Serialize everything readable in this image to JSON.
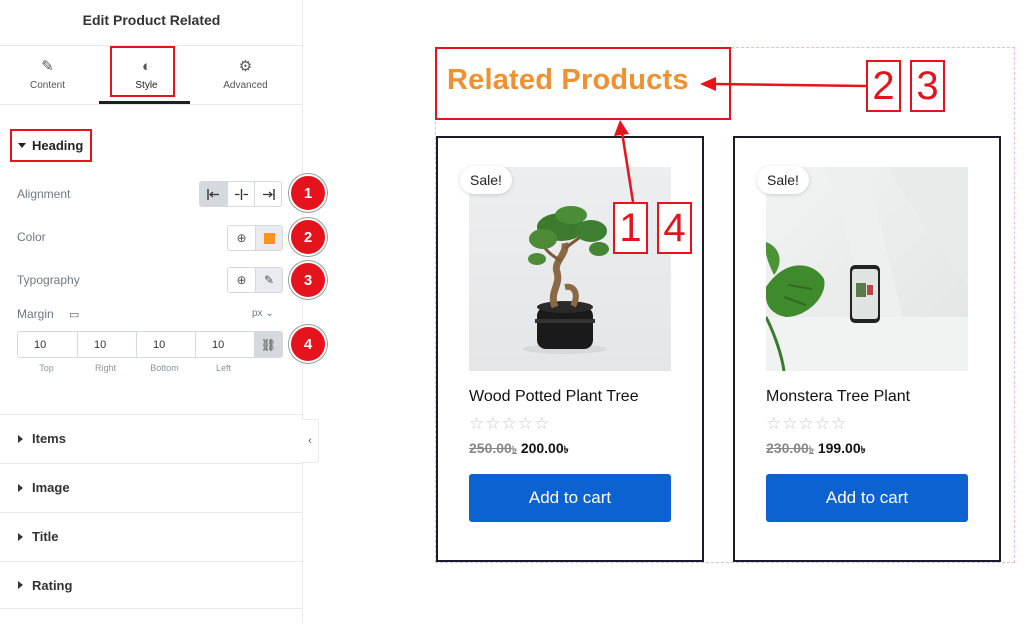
{
  "panel": {
    "title": "Edit Product Related",
    "tabs": [
      {
        "label": "Content",
        "icon": "pencil-icon"
      },
      {
        "label": "Style",
        "icon": "contrast-icon",
        "active": true
      },
      {
        "label": "Advanced",
        "icon": "gear-icon"
      }
    ],
    "heading_section": {
      "label": "Heading",
      "alignment_label": "Alignment",
      "alignment_options": [
        "left",
        "center",
        "right"
      ],
      "alignment_selected": "left",
      "color_label": "Color",
      "color_value": "#f7931e",
      "typography_label": "Typography",
      "margin_label": "Margin",
      "margin_unit": "px",
      "margin_values": [
        {
          "value": "10",
          "label": "Top"
        },
        {
          "value": "10",
          "label": "Right"
        },
        {
          "value": "10",
          "label": "Bottom"
        },
        {
          "value": "10",
          "label": "Left"
        }
      ]
    },
    "sections": [
      {
        "label": "Items"
      },
      {
        "label": "Image"
      },
      {
        "label": "Title"
      },
      {
        "label": "Rating"
      }
    ],
    "badges": [
      "1",
      "2",
      "3",
      "4"
    ]
  },
  "preview": {
    "heading": "Related Products",
    "heading_color": "#f0902f",
    "annotation_numbers": [
      "2",
      "3",
      "1",
      "4"
    ],
    "products": [
      {
        "sale_label": "Sale!",
        "title": "Wood Potted Plant Tree",
        "rating_stars": "☆☆☆☆☆",
        "old_price": "250.00",
        "new_price": "200.00",
        "currency": "৳",
        "button_label": "Add to cart"
      },
      {
        "sale_label": "Sale!",
        "title": "Monstera Tree Plant",
        "rating_stars": "☆☆☆☆☆",
        "old_price": "230.00",
        "new_price": "199.00",
        "currency": "৳",
        "button_label": "Add to cart"
      }
    ]
  },
  "colors": {
    "annotation_red": "#e5131b",
    "button_blue": "#0d62d1",
    "heading_orange": "#f0902f"
  }
}
